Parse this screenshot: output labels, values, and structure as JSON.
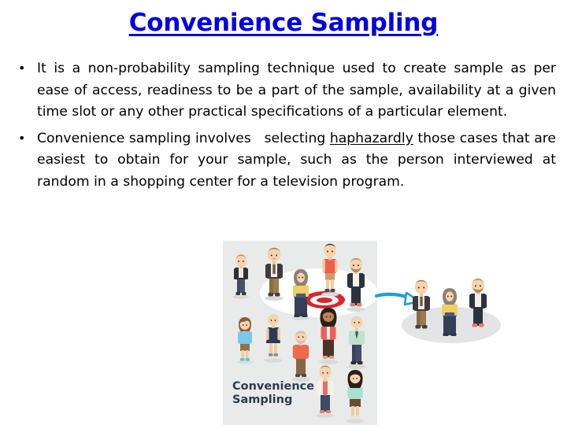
{
  "slide": {
    "title": "Convenience Sampling",
    "title_color": "#0000e0",
    "background_color": "#ffffff"
  },
  "bullets": [
    {
      "id": "bullet-1",
      "text": "It is a non-probability sampling technique used to create sample as per ease of access, readiness to be a part of the sample, availability at a given time slot or any other practical specifications of a particular element."
    },
    {
      "id": "bullet-2",
      "text_before": "Convenience sampling involves   selecting ",
      "underlined": "haphazardly",
      "text_after": " those cases that are easiest to obtain for your sample, such as the person interviewed at random in a shopping center for a television program."
    }
  ],
  "illustration": {
    "label_line1": "Convenience",
    "label_line2": "Sampling",
    "label_color": "#2b3a55",
    "panel_color": "#e9eaea",
    "target_color": "#d8272c",
    "arrow_color": "#1f9fd4",
    "selected_ellipse_color": "#e3e4e5",
    "crowd_count": 14,
    "selected_count": 3
  }
}
